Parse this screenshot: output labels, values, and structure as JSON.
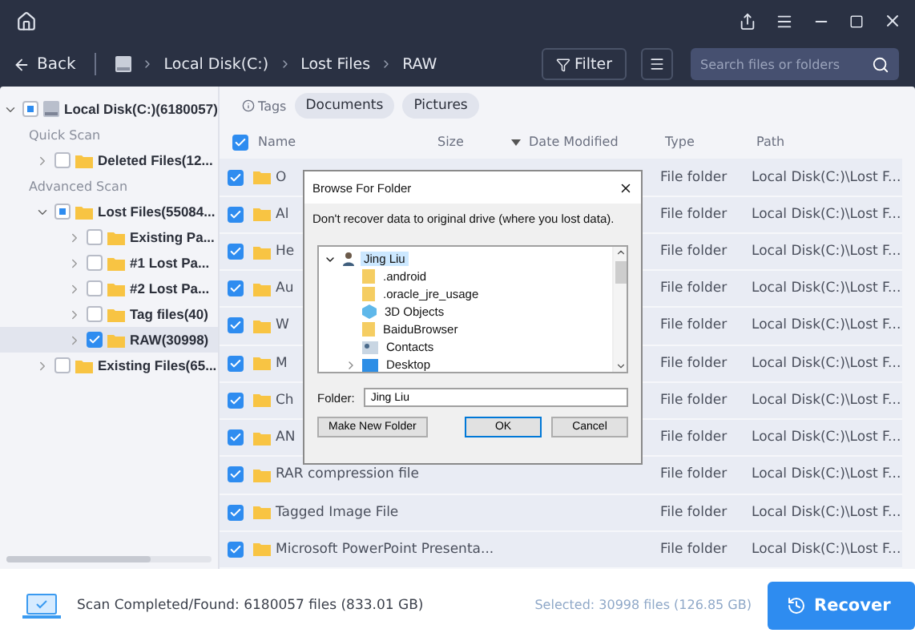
{
  "toolbar": {
    "back": "Back",
    "breadcrumb": [
      "Local Disk(C:)",
      "Lost Files",
      "RAW"
    ],
    "filter": "Filter",
    "search": {
      "placeholder": "Search files or folders"
    }
  },
  "sidebar": {
    "root": {
      "label": "Local Disk(C:)(6180057)",
      "expanded": true,
      "checked": false,
      "partial": true
    },
    "groups": [
      {
        "title": "Quick Scan",
        "items": [
          {
            "label": "Deleted Files(12...",
            "expanded": false,
            "checked": false,
            "partial": false,
            "selected": false
          }
        ]
      },
      {
        "title": "Advanced Scan",
        "items": [
          {
            "label": "Lost Files(55084...",
            "expanded": true,
            "checked": false,
            "partial": true,
            "selected": false,
            "children": [
              {
                "label": "Existing Pa...",
                "expanded": false,
                "checked": false,
                "partial": false,
                "selected": false
              },
              {
                "label": "#1 Lost Pa...",
                "expanded": false,
                "checked": false,
                "partial": false,
                "selected": false
              },
              {
                "label": "#2 Lost Pa...",
                "expanded": false,
                "checked": false,
                "partial": false,
                "selected": false
              },
              {
                "label": "Tag files(40)",
                "expanded": false,
                "checked": false,
                "partial": false,
                "selected": false
              },
              {
                "label": "RAW(30998)",
                "expanded": false,
                "checked": true,
                "selected": true
              }
            ]
          },
          {
            "label": "Existing Files(65...",
            "expanded": false,
            "checked": false,
            "partial": false,
            "selected": false
          }
        ]
      }
    ]
  },
  "tags": {
    "label": "Tags",
    "chips": [
      "Documents",
      "Pictures"
    ]
  },
  "table": {
    "select_all": true,
    "columns": [
      "Name",
      "Size",
      "Date Modified",
      "Type",
      "Path"
    ],
    "rows": [
      {
        "name": "O",
        "type": "File folder",
        "path": "Local Disk(C:)\\Lost F...",
        "checked": true
      },
      {
        "name": "Al",
        "type": "File folder",
        "path": "Local Disk(C:)\\Lost F...",
        "checked": true
      },
      {
        "name": "He",
        "type": "File folder",
        "path": "Local Disk(C:)\\Lost F...",
        "checked": true
      },
      {
        "name": "Au",
        "type": "File folder",
        "path": "Local Disk(C:)\\Lost F...",
        "checked": true
      },
      {
        "name": "W",
        "type": "File folder",
        "path": "Local Disk(C:)\\Lost F...",
        "checked": true
      },
      {
        "name": "M",
        "type": "File folder",
        "path": "Local Disk(C:)\\Lost F...",
        "checked": true
      },
      {
        "name": "Ch",
        "type": "File folder",
        "path": "Local Disk(C:)\\Lost F...",
        "checked": true
      },
      {
        "name": "AN",
        "type": "File folder",
        "path": "Local Disk(C:)\\Lost F...",
        "checked": true
      },
      {
        "name": "RAR compression file",
        "type": "File folder",
        "path": "Local Disk(C:)\\Lost F...",
        "checked": true
      },
      {
        "name": "Tagged Image File",
        "type": "File folder",
        "path": "Local Disk(C:)\\Lost F...",
        "checked": true
      },
      {
        "name": "Microsoft PowerPoint Presenta...",
        "type": "File folder",
        "path": "Local Disk(C:)\\Lost F...",
        "checked": true
      }
    ]
  },
  "dialog": {
    "title": "Browse For Folder",
    "message": "Don't recover data to original drive (where you lost data).",
    "tree": [
      {
        "label": "Jing Liu",
        "kind": "user",
        "expanded": true,
        "selected": true,
        "children": [
          {
            "label": ".android",
            "kind": "folder"
          },
          {
            "label": ".oracle_jre_usage",
            "kind": "folder"
          },
          {
            "label": "3D Objects",
            "kind": "objects"
          },
          {
            "label": "BaiduBrowser",
            "kind": "folder"
          },
          {
            "label": "Contacts",
            "kind": "contacts"
          },
          {
            "label": "Desktop",
            "kind": "desktop",
            "expanded": false
          }
        ]
      }
    ],
    "folder_label": "Folder:",
    "folder_value": "Jing Liu",
    "buttons": [
      "Make New Folder",
      "OK",
      "Cancel"
    ]
  },
  "footer": {
    "status": "Scan Completed/Found: 6180057 files (833.01 GB)",
    "selected": "Selected: 30998 files (126.85 GB)",
    "recover": "Recover"
  }
}
